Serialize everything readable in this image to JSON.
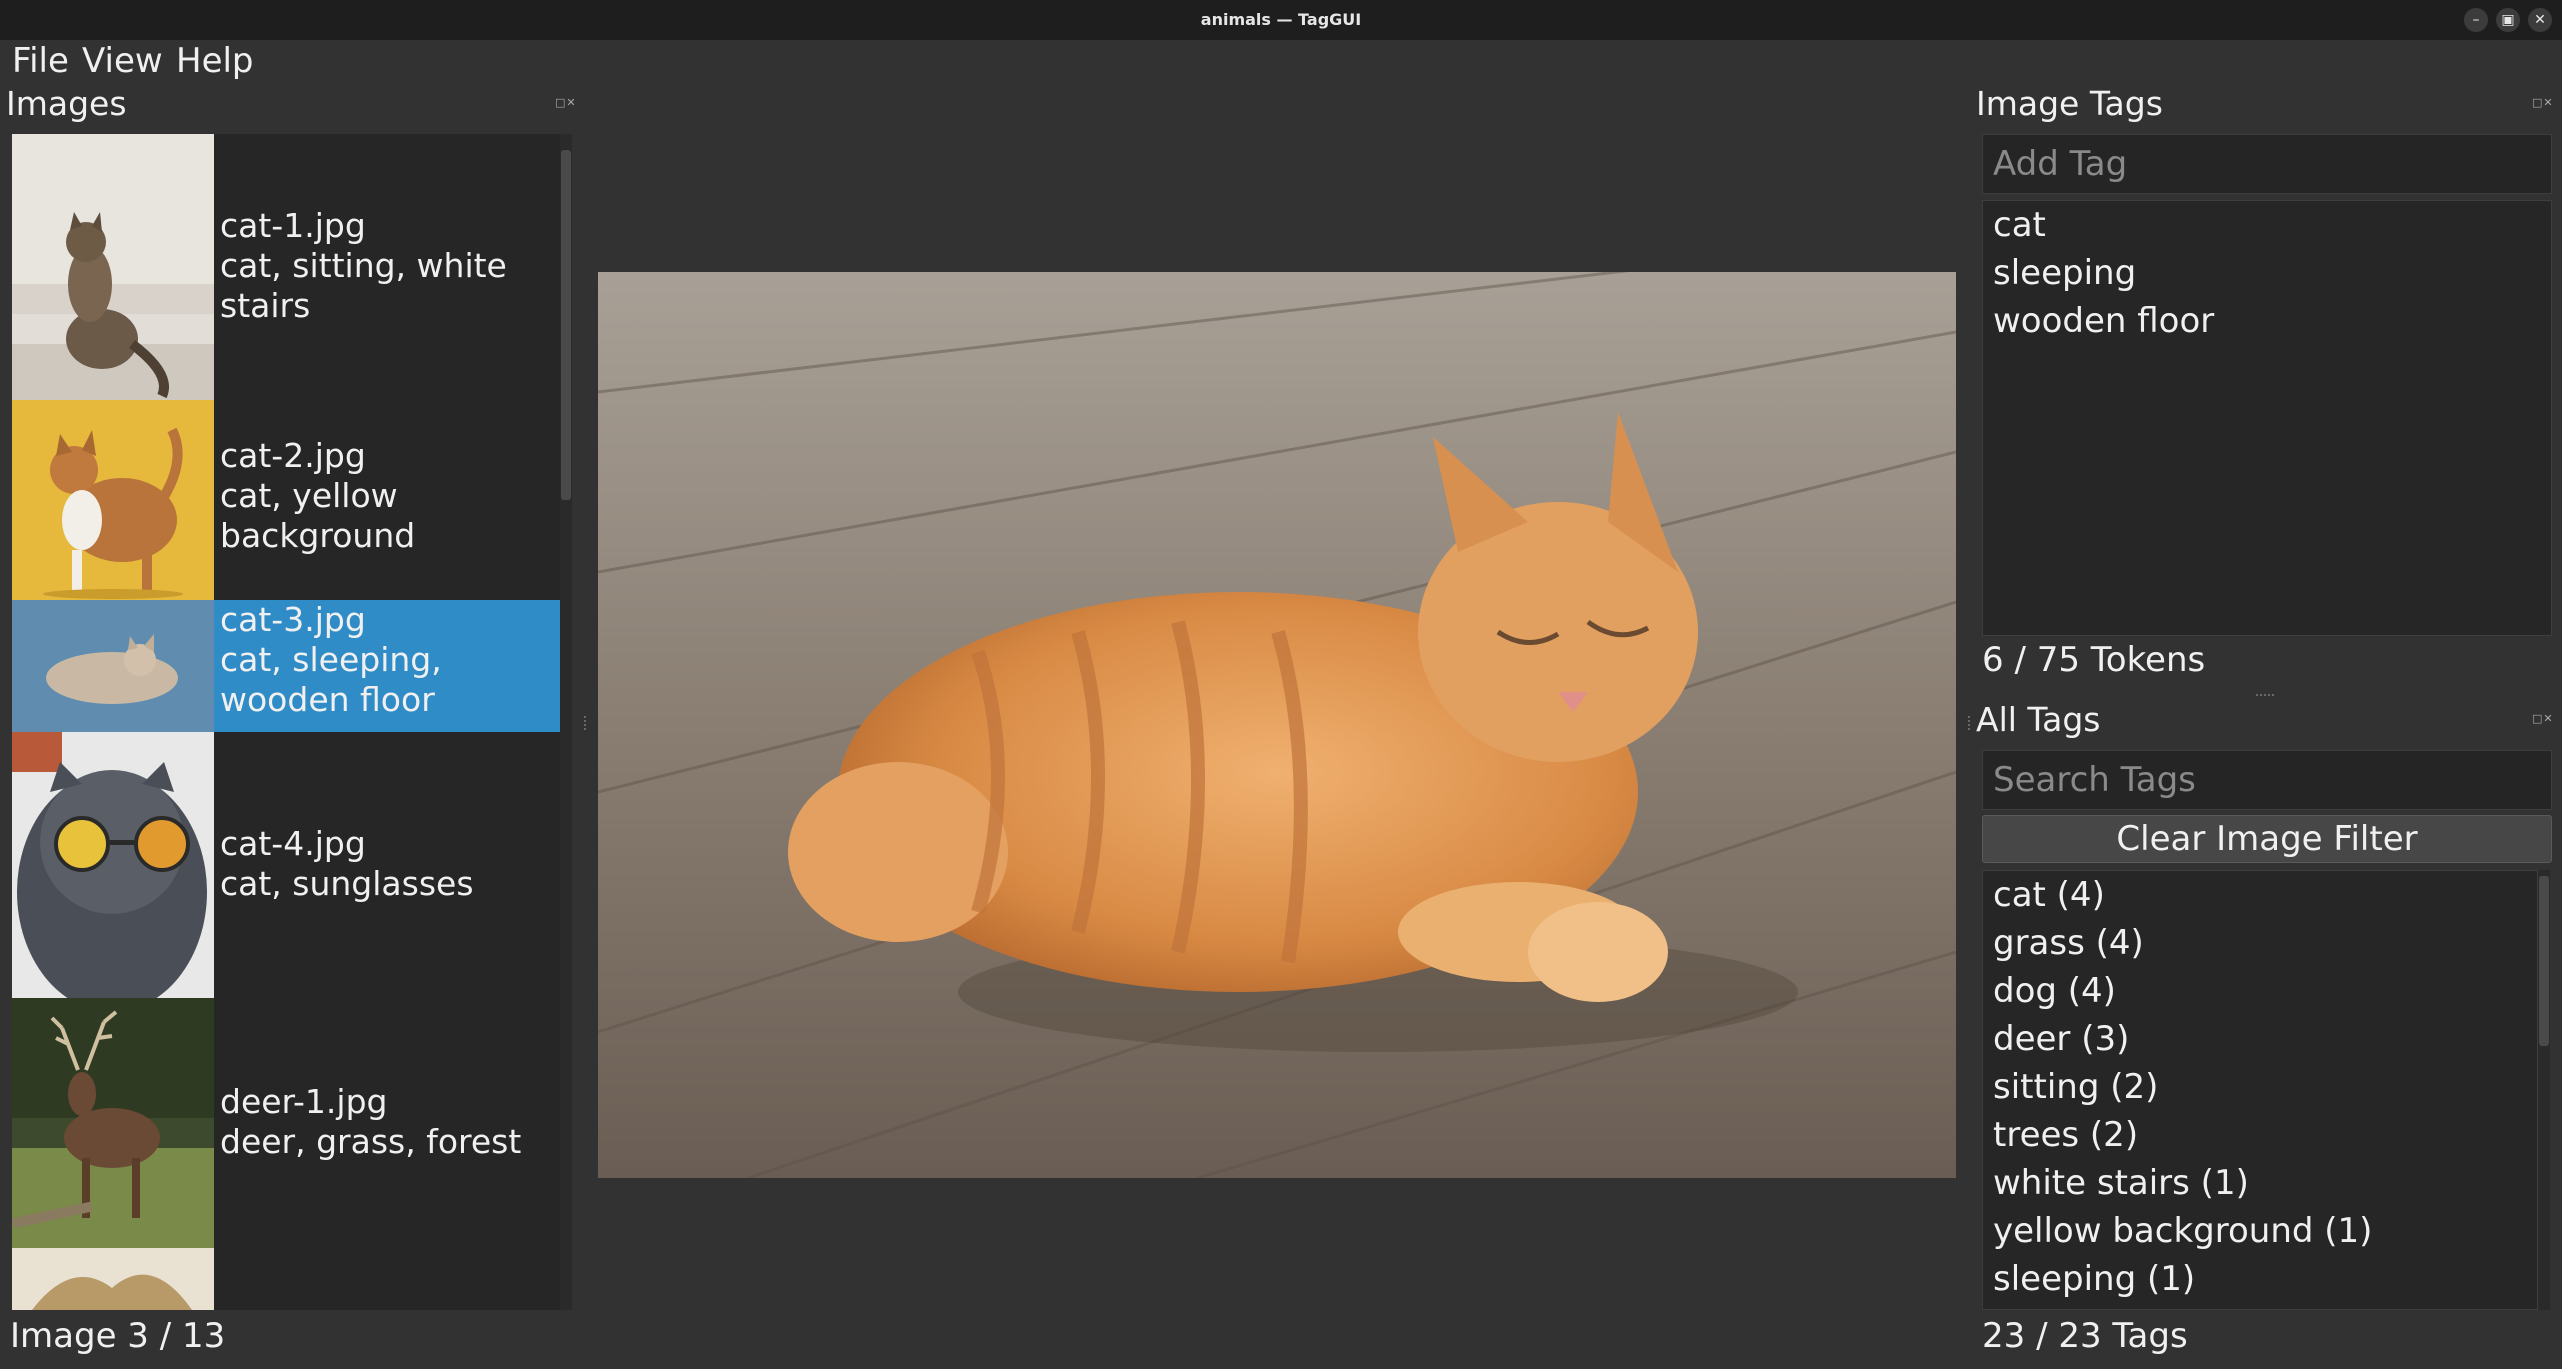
{
  "window": {
    "title": "animals — TagGUI",
    "minimize_icon": "minimize-icon",
    "maximize_icon": "maximize-icon",
    "close_icon": "close-icon"
  },
  "menu": [
    "File",
    "View",
    "Help"
  ],
  "images_panel": {
    "title": "Images",
    "items": [
      {
        "filename": "cat-1.jpg",
        "tags": "cat, sitting, white stairs",
        "selected": false
      },
      {
        "filename": "cat-2.jpg",
        "tags": "cat, yellow background",
        "selected": false
      },
      {
        "filename": "cat-3.jpg",
        "tags": "cat, sleeping, wooden floor",
        "selected": true
      },
      {
        "filename": "cat-4.jpg",
        "tags": "cat, sunglasses",
        "selected": false
      },
      {
        "filename": "deer-1.jpg",
        "tags": "deer, grass, forest",
        "selected": false
      }
    ],
    "status": "Image 3 / 13"
  },
  "image_tags_panel": {
    "title": "Image Tags",
    "add_tag_placeholder": "Add Tag",
    "tags": [
      "cat",
      "sleeping",
      "wooden floor"
    ],
    "token_count": "6 / 75 Tokens"
  },
  "all_tags_panel": {
    "title": "All Tags",
    "search_placeholder": "Search Tags",
    "clear_button": "Clear Image Filter",
    "tags": [
      "cat (4)",
      "grass (4)",
      "dog (4)",
      "deer (3)",
      "sitting (2)",
      "trees (2)",
      "white stairs (1)",
      "yellow background (1)",
      "sleeping (1)"
    ],
    "status": "23 / 23 Tags"
  },
  "colors": {
    "selection": "#308cc6",
    "background": "#323232",
    "list_bg": "#262626"
  }
}
